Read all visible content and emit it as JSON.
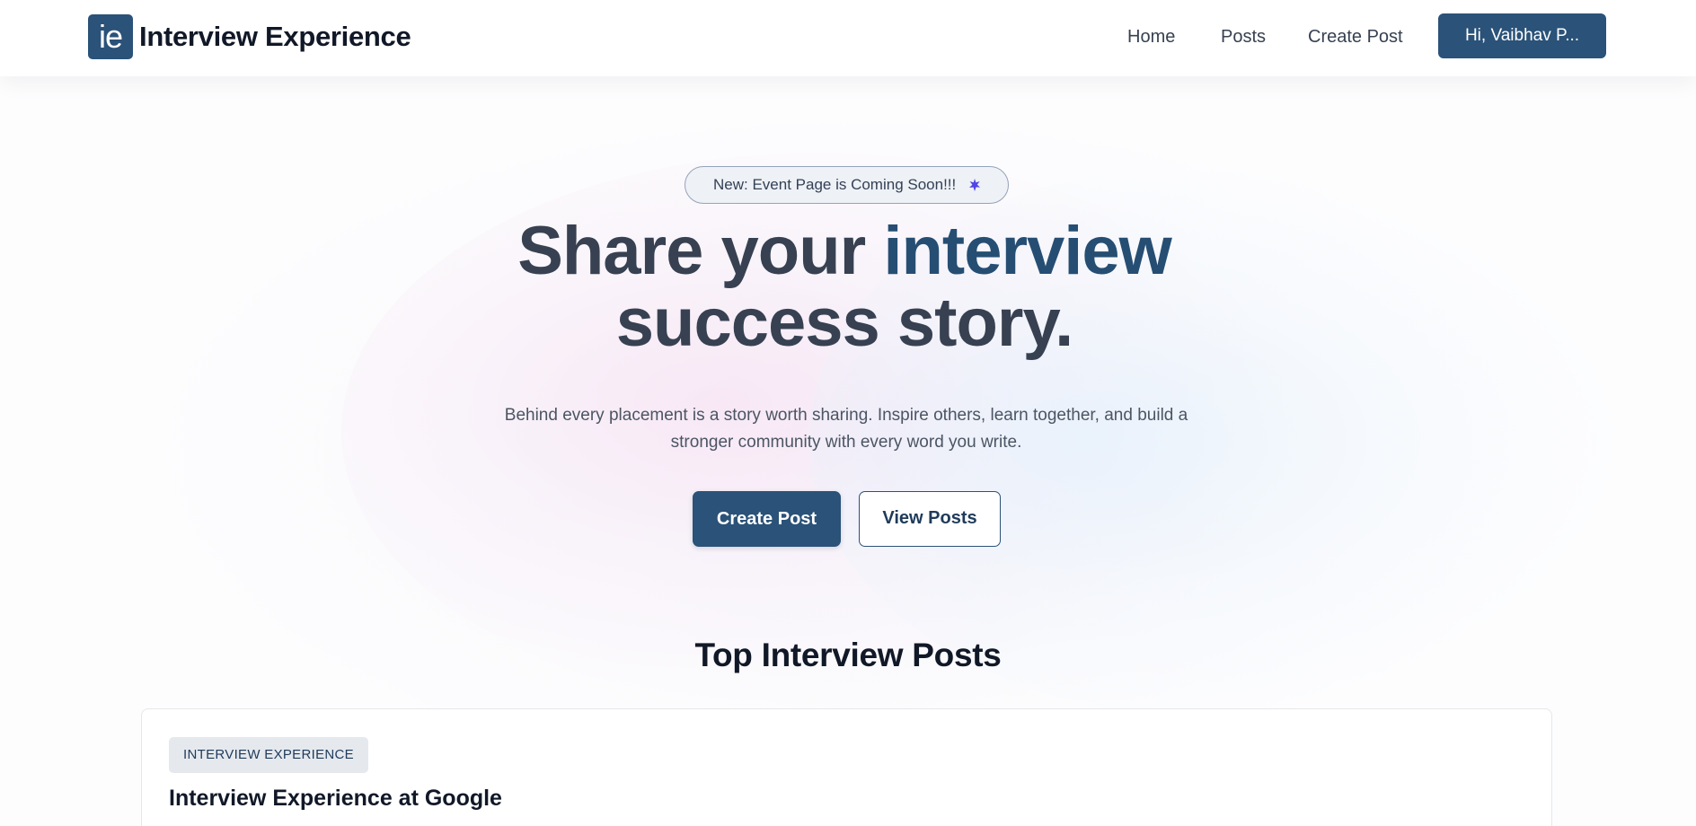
{
  "header": {
    "logo_text": "ie",
    "brand": "Interview Experience",
    "nav": [
      {
        "label": "Home"
      },
      {
        "label": "Posts"
      },
      {
        "label": "Create Post"
      }
    ],
    "user_button": "Hi, Vaibhav P..."
  },
  "announcement": {
    "text": "New: Event Page is Coming Soon!!!",
    "icon": "sparkle-icon",
    "icon_color": "#4f46e5"
  },
  "hero": {
    "title_part1": "Share your ",
    "title_accent": "interview",
    "title_line2": "success story.",
    "subtitle_line1": "Behind every placement is a story worth sharing. Inspire others, learn together, and build a",
    "subtitle_line2": "stronger community with every word you write.",
    "primary_button": "Create Post",
    "secondary_button": "View Posts"
  },
  "top_posts": {
    "title": "Top Interview Posts",
    "posts": [
      {
        "tag": "INTERVIEW EXPERIENCE",
        "title": "Interview Experience at Google"
      }
    ]
  },
  "colors": {
    "primary": "#2b5278",
    "accent_text": "#264e73",
    "heading": "#374151"
  }
}
